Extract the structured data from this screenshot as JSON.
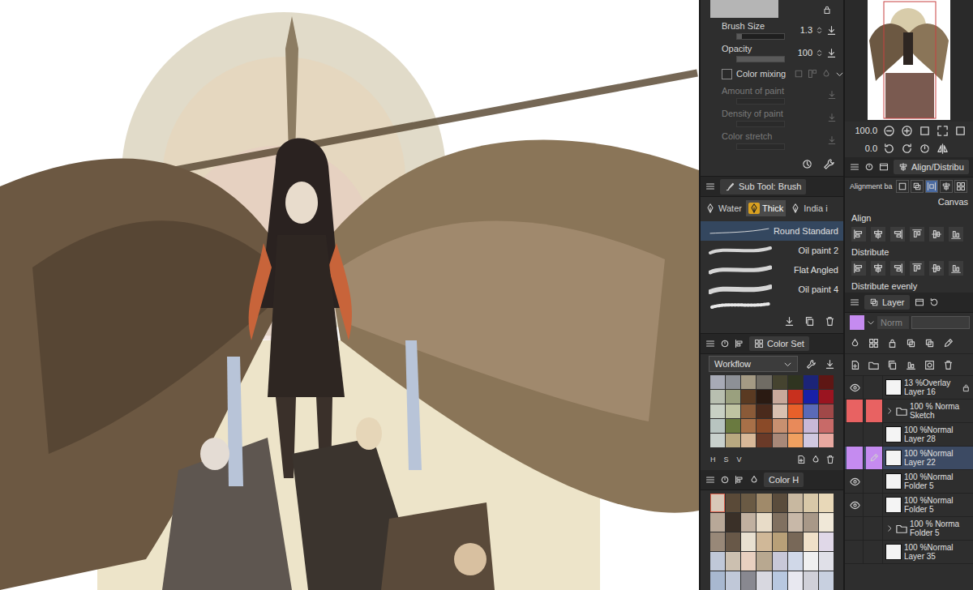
{
  "tool_property": {
    "sliders": [
      {
        "label": "Brush Size",
        "value": "1.3",
        "level": 0.1
      },
      {
        "label": "Opacity",
        "value": "100",
        "level": 1
      }
    ],
    "color_mixing": {
      "label": "Color mixing",
      "checked": false
    },
    "disabled_rows": [
      {
        "label": "Amount of paint",
        "disabled": true
      },
      {
        "label": "Density of paint",
        "disabled": true
      },
      {
        "label": "Color stretch",
        "disabled": true
      }
    ]
  },
  "sub_tool": {
    "title": "Sub Tool: Brush",
    "tabs": [
      {
        "label": "Water",
        "selected": false
      },
      {
        "label": "Thick",
        "selected": true
      },
      {
        "label": "India i",
        "selected": false
      }
    ],
    "brushes": [
      {
        "name": "Round Standard",
        "selected": true
      },
      {
        "name": "Oil paint 2",
        "selected": false
      },
      {
        "name": "Flat Angled",
        "selected": false
      },
      {
        "name": "Oil paint 4",
        "selected": false
      }
    ]
  },
  "color_set": {
    "title": "Color Set",
    "set": "Workflow",
    "swatches": [
      "#a7aab6",
      "#8d9096",
      "#a49a84",
      "#706c64",
      "#45432f",
      "#2f3420",
      "#1c2478",
      "#5e1614",
      "#b8bfb0",
      "#9aa07e",
      "#5a3a22",
      "#2a1a12",
      "#c8a89a",
      "#c8301e",
      "#1820a8",
      "#9a1420",
      "#c8d0c4",
      "#bfc3a2",
      "#8a5a38",
      "#4a2a1c",
      "#d8c0b0",
      "#e8602a",
      "#5a6ab8",
      "#a04848",
      "#b8c4c0",
      "#6a7a40",
      "#a87048",
      "#8a4a28",
      "#c89070",
      "#e88a5a",
      "#c8b8d8",
      "#c86a68",
      "#c8d0cc",
      "#b8a880",
      "#d8b898",
      "#6a3a28",
      "#a88878",
      "#f0a060",
      "#d0c8e0",
      "#e8a8a0"
    ],
    "modes": [
      "H",
      "S",
      "V"
    ]
  },
  "color_history": {
    "title": "Color H",
    "swatches": [
      "#d8c8b8",
      "#5a4a38",
      "#6a5a44",
      "#a08a6a",
      "#5a4c3c",
      "#c8b8a0",
      "#d8c8a8",
      "#e8d8b8",
      "#b8a898",
      "#3a3028",
      "#c0b0a0",
      "#e8dcc8",
      "#807060",
      "#c8b8a8",
      "#a89888",
      "#f0e8d8",
      "#988878",
      "#685848",
      "#e8e0d0",
      "#d0b898",
      "#b8a078",
      "#786858",
      "#f0e0c8",
      "#e0d8e8",
      "#c0c8d8",
      "#ccc0b0",
      "#e8d0c0",
      "#b8a890",
      "#c8c8d8",
      "#d0d8e8",
      "#f0f0f0",
      "#e0e0e8",
      "#a8b8d0",
      "#c0c8d8",
      "#888890",
      "#d8d8e0",
      "#b8c8e0",
      "#e8e8f0",
      "#d0d0d8",
      "#c8d0e0"
    ]
  },
  "navigator": {
    "zoom": "100.0",
    "rotation": "0.0"
  },
  "align": {
    "title": "Align/Distribu",
    "basis_label": "Alignment ba",
    "basis": "Canvas",
    "sections": [
      "Align",
      "Distribute",
      "Distribute evenly"
    ]
  },
  "layer_panel": {
    "title": "Layer",
    "blend": "Norm",
    "current_color": "#c58bf0",
    "layers": [
      {
        "blend": "13 %Overlay",
        "name": "Layer 16",
        "kind": "layer",
        "visible": true,
        "locked": true,
        "selected": false,
        "editing": false
      },
      {
        "blend": "100 % Norma",
        "name": "Sketch",
        "kind": "folder",
        "visible": false,
        "locked": false,
        "selected": false,
        "editing": false,
        "color": "#e86262"
      },
      {
        "blend": "100 %Normal",
        "name": "Layer 28",
        "kind": "layer",
        "visible": false,
        "locked": false,
        "selected": false,
        "editing": false
      },
      {
        "blend": "100 %Normal",
        "name": "Layer 22",
        "kind": "layer",
        "visible": false,
        "locked": false,
        "selected": true,
        "editing": true,
        "color": "#c58bf0"
      },
      {
        "blend": "100 %Normal",
        "name": "Folder 5",
        "kind": "layer",
        "visible": true,
        "locked": false,
        "selected": false,
        "editing": false
      },
      {
        "blend": "100 %Normal",
        "name": "Folder 5",
        "kind": "layer",
        "visible": true,
        "locked": false,
        "selected": false,
        "editing": false
      },
      {
        "blend": "100 % Norma",
        "name": "Folder 5",
        "kind": "folder",
        "visible": false,
        "locked": false,
        "selected": false,
        "editing": false
      },
      {
        "blend": "100 %Normal",
        "name": "Layer 35",
        "kind": "layer",
        "visible": false,
        "locked": false,
        "selected": false,
        "editing": false
      }
    ]
  }
}
